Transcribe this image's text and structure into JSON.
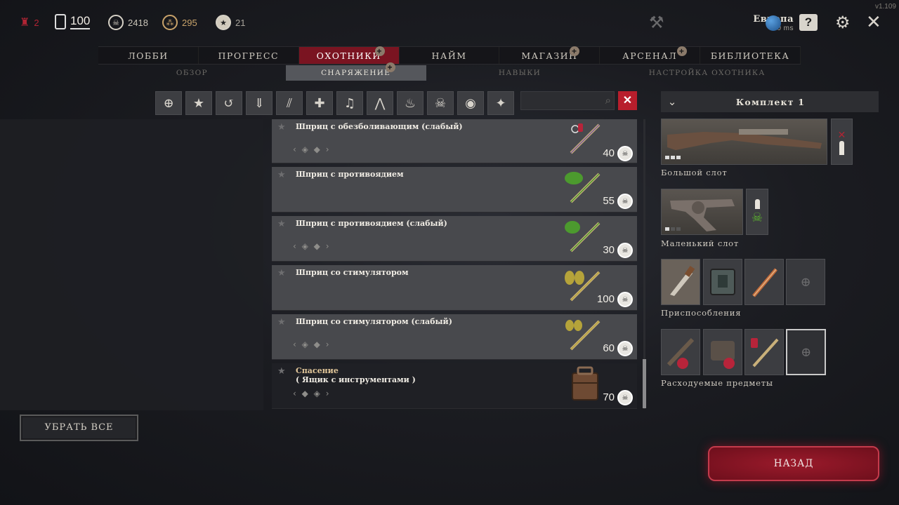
{
  "version": "v1.109",
  "currencies": {
    "rank": "2",
    "bloodbonds": "100",
    "hunt_dollars": "2418",
    "event_points": "295",
    "stars": "21"
  },
  "server": {
    "region": "Европа",
    "ping": "40 ms"
  },
  "main_tabs": [
    "ЛОББИ",
    "ПРОГРЕСС",
    "ОХОТНИКИ",
    "НАЙМ",
    "МАГАЗИН",
    "АРСЕНАЛ",
    "БИБЛИОТЕКА"
  ],
  "sub_tabs": [
    "ОБЗОР",
    "СНАРЯЖЕНИЕ",
    "НАВЫКИ",
    "НАСТРОЙКА ОХОТНИКА"
  ],
  "filters": [
    "plus-icon",
    "star-icon",
    "hook-icon",
    "drop-icon",
    "claw-icon",
    "medkit-icon",
    "bell-icon",
    "grass-icon",
    "fire-icon",
    "skull-icon",
    "eye-icon",
    "lamp-icon"
  ],
  "search": {
    "placeholder": ""
  },
  "items": [
    {
      "name": "Шприц с обезболивающим (слабый)",
      "price": "40",
      "variants": true,
      "art_color": "#b7243a"
    },
    {
      "name": "Шприц с противоядием",
      "price": "55",
      "variants": false,
      "art_color": "#4c9a2e"
    },
    {
      "name": "Шприц с противоядием (слабый)",
      "price": "30",
      "variants": true,
      "art_color": "#4c9a2e"
    },
    {
      "name": "Шприц со стимулятором",
      "price": "100",
      "variants": false,
      "art_color": "#b5a33a"
    },
    {
      "name": "Шприц со стимулятором (слабый)",
      "price": "60",
      "variants": true,
      "art_color": "#b5a33a"
    },
    {
      "name": "Спасение",
      "subtitle": "( Ящик с инструментами )",
      "price": "70",
      "variants": true,
      "art_color": "#6e4a33"
    }
  ],
  "loadout": {
    "kit_title": "Комплект 1",
    "large_slot": "Большой слот",
    "small_slot": "Маленький слот",
    "tools": "Приспособления",
    "consumables": "Расходуемые предметы"
  },
  "buttons": {
    "remove_all": "УБРАТЬ ВСЕ",
    "back": "НАЗАД"
  }
}
